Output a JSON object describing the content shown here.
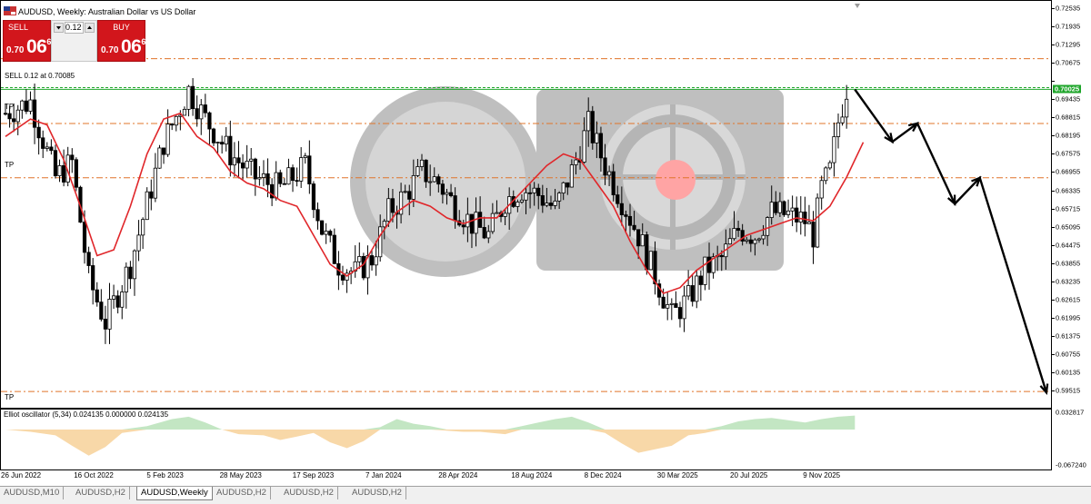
{
  "header": {
    "title": "AUDUSD, Weekly:  Australian Dollar vs US Dollar"
  },
  "trade_panel": {
    "sell_label": "SELL",
    "buy_label": "BUY",
    "volume": "0.12",
    "sell_price_prefix": "0.70",
    "sell_price_main": "06",
    "sell_price_sup": "6",
    "buy_price_prefix": "0.70",
    "buy_price_main": "06",
    "buy_price_sup": "6"
  },
  "chart_labels": {
    "sell_line": "SELL 0.12 at 0.70085",
    "tp_upper": "TP",
    "tp_mid": "TP",
    "tp_lower": "TP"
  },
  "oscillator": {
    "title": "Elliot oscillator (5,34) 0.024135 0.000000 0.024135"
  },
  "price_axis": {
    "labels": [
      "0.72535",
      "0.71935",
      "0.71295",
      "0.70675",
      "0.70025",
      "0.69435",
      "0.68815",
      "0.68195",
      "0.67575",
      "0.66955",
      "0.66335",
      "0.65715",
      "0.65095",
      "0.64475",
      "0.63855",
      "0.63235",
      "0.62615",
      "0.61995",
      "0.61375",
      "0.60755",
      "0.60135",
      "0.59515"
    ],
    "bid": "0.70025",
    "osc_top": "0.032817",
    "osc_bottom": "-0.067240"
  },
  "time_axis": {
    "labels": [
      "26 Jun 2022",
      "16 Oct 2022",
      "5 Feb 2023",
      "28 May 2023",
      "17 Sep 2023",
      "7 Jan 2024",
      "28 Apr 2024",
      "18 Aug 2024",
      "8 Dec 2024",
      "30 Mar 2025",
      "20 Jul 2025",
      "9 Nov 2025"
    ]
  },
  "tabs": [
    {
      "label": "AUDUSD,M10",
      "active": false
    },
    {
      "label": "AUDUSD,H2",
      "active": false
    },
    {
      "label": "AUDUSD,Weekly",
      "active": true
    },
    {
      "label": "AUDUSD,H2",
      "active": false
    },
    {
      "label": "AUDUSD,H2",
      "active": false
    },
    {
      "label": "AUDUSD,H2",
      "active": false
    }
  ],
  "colors": {
    "sell": "#d2161c",
    "ma": "#e0262a",
    "bid_line": "#1fa62b",
    "tp_line": "#e0742a",
    "osc_pos": "#c3e6c3",
    "osc_neg": "#f8d8a8"
  },
  "chart_data": {
    "type": "candlestick",
    "symbol": "AUDUSD",
    "timeframe": "Weekly",
    "y_range": [
      0.5925,
      0.7285
    ],
    "x_labels": [
      "26 Jun 2022",
      "16 Oct 2022",
      "5 Feb 2023",
      "28 May 2023",
      "17 Sep 2023",
      "7 Jan 2024",
      "28 Apr 2024",
      "18 Aug 2024",
      "8 Dec 2024",
      "30 Mar 2025",
      "20 Jul 2025",
      "9 Nov 2025"
    ],
    "close_path": [
      [
        0,
        0.692
      ],
      [
        6,
        0.696
      ],
      [
        12,
        0.67
      ],
      [
        16,
        0.675
      ],
      [
        20,
        0.635
      ],
      [
        24,
        0.62
      ],
      [
        30,
        0.64
      ],
      [
        38,
        0.682
      ],
      [
        44,
        0.7
      ],
      [
        48,
        0.69
      ],
      [
        54,
        0.678
      ],
      [
        60,
        0.67
      ],
      [
        66,
        0.666
      ],
      [
        72,
        0.674
      ],
      [
        76,
        0.652
      ],
      [
        80,
        0.64
      ],
      [
        84,
        0.637
      ],
      [
        88,
        0.642
      ],
      [
        92,
        0.658
      ],
      [
        96,
        0.664
      ],
      [
        100,
        0.672
      ],
      [
        104,
        0.668
      ],
      [
        108,
        0.66
      ],
      [
        112,
        0.654
      ],
      [
        116,
        0.65
      ],
      [
        120,
        0.662
      ],
      [
        124,
        0.666
      ],
      [
        128,
        0.664
      ],
      [
        132,
        0.659
      ],
      [
        136,
        0.672
      ],
      [
        140,
        0.688
      ],
      [
        144,
        0.674
      ],
      [
        148,
        0.662
      ],
      [
        152,
        0.65
      ],
      [
        156,
        0.636
      ],
      [
        160,
        0.622
      ],
      [
        164,
        0.628
      ],
      [
        168,
        0.638
      ],
      [
        172,
        0.642
      ],
      [
        176,
        0.652
      ],
      [
        180,
        0.65
      ],
      [
        184,
        0.658
      ],
      [
        188,
        0.657
      ],
      [
        192,
        0.655
      ],
      [
        194,
        0.65
      ],
      [
        196,
        0.666
      ],
      [
        198,
        0.672
      ],
      [
        200,
        0.689
      ],
      [
        202,
        0.7005
      ]
    ],
    "ma_path": [
      [
        0,
        0.684
      ],
      [
        6,
        0.69
      ],
      [
        10,
        0.688
      ],
      [
        14,
        0.676
      ],
      [
        18,
        0.66
      ],
      [
        22,
        0.643
      ],
      [
        26,
        0.645
      ],
      [
        30,
        0.66
      ],
      [
        34,
        0.678
      ],
      [
        38,
        0.69
      ],
      [
        42,
        0.692
      ],
      [
        46,
        0.684
      ],
      [
        50,
        0.68
      ],
      [
        54,
        0.672
      ],
      [
        58,
        0.668
      ],
      [
        62,
        0.666
      ],
      [
        66,
        0.662
      ],
      [
        70,
        0.66
      ],
      [
        74,
        0.65
      ],
      [
        78,
        0.64
      ],
      [
        82,
        0.636
      ],
      [
        86,
        0.64
      ],
      [
        90,
        0.65
      ],
      [
        94,
        0.658
      ],
      [
        98,
        0.662
      ],
      [
        102,
        0.66
      ],
      [
        106,
        0.656
      ],
      [
        110,
        0.654
      ],
      [
        114,
        0.656
      ],
      [
        118,
        0.656
      ],
      [
        122,
        0.662
      ],
      [
        126,
        0.668
      ],
      [
        130,
        0.674
      ],
      [
        134,
        0.678
      ],
      [
        138,
        0.676
      ],
      [
        142,
        0.668
      ],
      [
        146,
        0.66
      ],
      [
        150,
        0.648
      ],
      [
        154,
        0.638
      ],
      [
        158,
        0.63
      ],
      [
        162,
        0.632
      ],
      [
        166,
        0.638
      ],
      [
        170,
        0.642
      ],
      [
        174,
        0.646
      ],
      [
        178,
        0.65
      ],
      [
        182,
        0.652
      ],
      [
        186,
        0.654
      ],
      [
        190,
        0.656
      ],
      [
        194,
        0.655
      ],
      [
        198,
        0.66
      ],
      [
        202,
        0.67
      ],
      [
        206,
        0.682
      ]
    ],
    "levels": {
      "bid": 0.70025,
      "sell_entry": 0.70085,
      "tp_upper": 0.7108,
      "tp_mid_upper": 0.6885,
      "tp_mid": 0.6698,
      "tp_lower": 0.5962
    },
    "forecast_path": [
      [
        204,
        0.7002
      ],
      [
        213,
        0.6822
      ],
      [
        219,
        0.6885
      ],
      [
        228,
        0.6608
      ],
      [
        234,
        0.6698
      ],
      [
        250,
        0.5958
      ]
    ],
    "oscillator": {
      "title": "Elliot oscillator (5,34) 0.024135 0.000000 0.024135",
      "y_range": [
        -0.06724,
        0.032817
      ],
      "values": [
        [
          0,
          0.0
        ],
        [
          6,
          -0.004
        ],
        [
          12,
          -0.01
        ],
        [
          16,
          -0.028
        ],
        [
          20,
          -0.045
        ],
        [
          24,
          -0.03
        ],
        [
          28,
          -0.006
        ],
        [
          34,
          0.006
        ],
        [
          40,
          0.018
        ],
        [
          44,
          0.022
        ],
        [
          48,
          0.012
        ],
        [
          52,
          0.0
        ],
        [
          56,
          -0.008
        ],
        [
          62,
          -0.01
        ],
        [
          66,
          -0.018
        ],
        [
          70,
          -0.012
        ],
        [
          74,
          -0.006
        ],
        [
          78,
          -0.022
        ],
        [
          82,
          -0.032
        ],
        [
          86,
          -0.02
        ],
        [
          90,
          0.004
        ],
        [
          94,
          0.018
        ],
        [
          98,
          0.01
        ],
        [
          102,
          0.006
        ],
        [
          106,
          -0.002
        ],
        [
          110,
          -0.004
        ],
        [
          114,
          -0.004
        ],
        [
          120,
          -0.008
        ],
        [
          124,
          0.006
        ],
        [
          128,
          0.012
        ],
        [
          132,
          0.018
        ],
        [
          136,
          0.022
        ],
        [
          140,
          0.012
        ],
        [
          144,
          -0.006
        ],
        [
          148,
          -0.024
        ],
        [
          152,
          -0.04
        ],
        [
          156,
          -0.034
        ],
        [
          160,
          -0.028
        ],
        [
          164,
          -0.01
        ],
        [
          168,
          -0.006
        ],
        [
          172,
          0.006
        ],
        [
          176,
          0.014
        ],
        [
          180,
          0.018
        ],
        [
          184,
          0.02
        ],
        [
          188,
          0.016
        ],
        [
          192,
          0.012
        ],
        [
          196,
          0.018
        ],
        [
          200,
          0.022
        ],
        [
          204,
          0.024135
        ]
      ]
    }
  }
}
